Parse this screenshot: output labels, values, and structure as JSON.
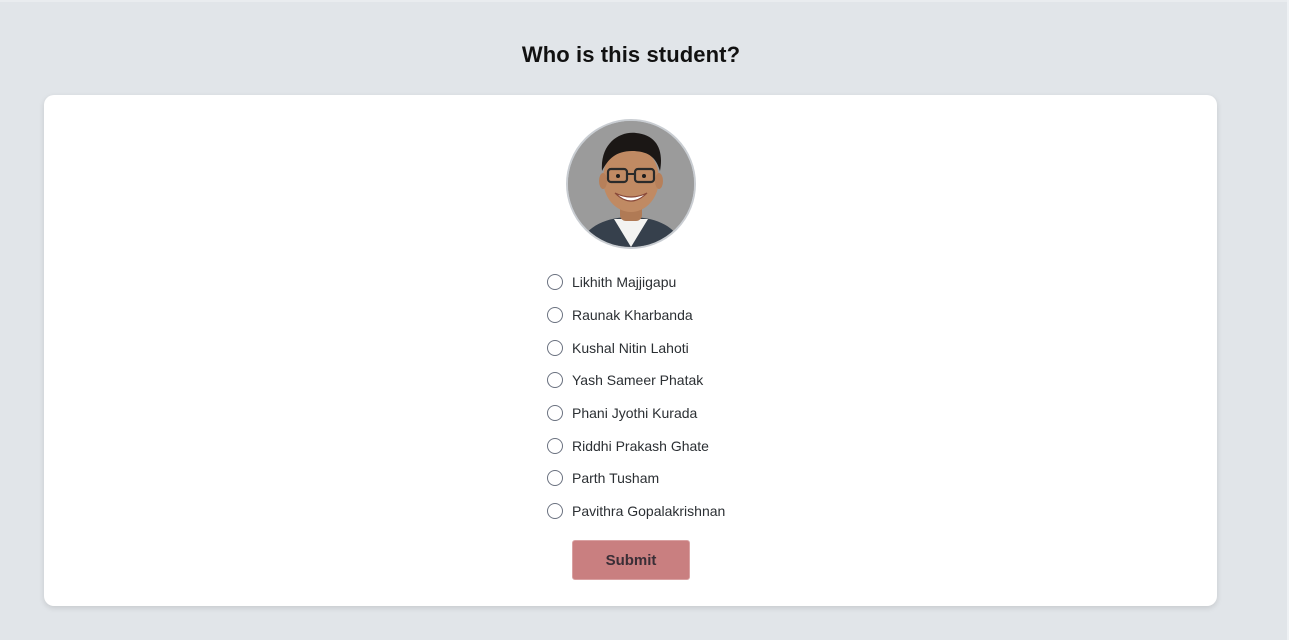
{
  "page": {
    "title": "Who is this student?"
  },
  "avatar": {
    "icon": "student-photo"
  },
  "options": [
    {
      "label": "Likhith Majjigapu"
    },
    {
      "label": "Raunak Kharbanda"
    },
    {
      "label": "Kushal Nitin Lahoti"
    },
    {
      "label": "Yash Sameer Phatak"
    },
    {
      "label": "Phani Jyothi Kurada"
    },
    {
      "label": "Riddhi Prakash Ghate"
    },
    {
      "label": "Parth Tusham"
    },
    {
      "label": "Pavithra Gopalakrishnan"
    }
  ],
  "submit": {
    "label": "Submit"
  },
  "colors": {
    "background": "#e1e5e9",
    "card": "#ffffff",
    "submit_button": "#c97f80"
  }
}
